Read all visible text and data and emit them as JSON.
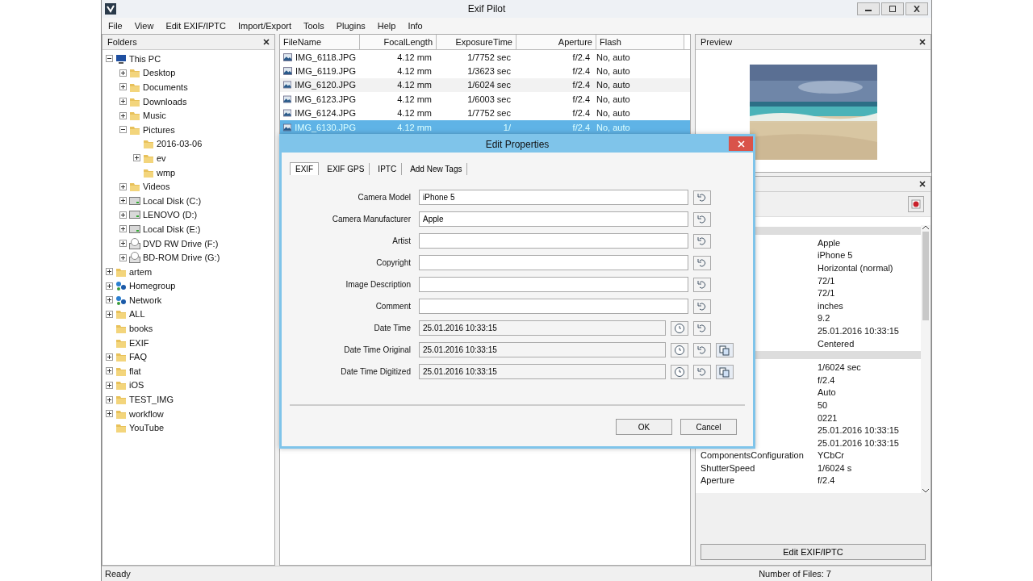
{
  "window": {
    "title": "Exif Pilot"
  },
  "menu": [
    "File",
    "View",
    "Edit EXIF/IPTC",
    "Import/Export",
    "Tools",
    "Plugins",
    "Help",
    "Info"
  ],
  "folders": {
    "title": "Folders",
    "tree": [
      {
        "label": "This PC",
        "kind": "computer",
        "expanded": true,
        "children": [
          {
            "label": "Desktop",
            "kind": "folder",
            "expanded": false
          },
          {
            "label": "Documents",
            "kind": "folder",
            "expanded": false
          },
          {
            "label": "Downloads",
            "kind": "folder",
            "expanded": false
          },
          {
            "label": "Music",
            "kind": "folder",
            "expanded": false
          },
          {
            "label": "Pictures",
            "kind": "folder",
            "expanded": true,
            "children": [
              {
                "label": "2016-03-06",
                "kind": "folder"
              },
              {
                "label": "ev",
                "kind": "folder",
                "expanded": false
              },
              {
                "label": "wmp",
                "kind": "folder"
              }
            ]
          },
          {
            "label": "Videos",
            "kind": "folder",
            "expanded": false
          },
          {
            "label": "Local Disk (C:)",
            "kind": "disk",
            "expanded": false
          },
          {
            "label": "LENOVO (D:)",
            "kind": "disk",
            "expanded": false
          },
          {
            "label": "Local Disk (E:)",
            "kind": "disk",
            "expanded": false
          },
          {
            "label": "DVD RW Drive (F:)",
            "kind": "optical",
            "expanded": false
          },
          {
            "label": "BD-ROM Drive (G:)",
            "kind": "optical",
            "expanded": false
          }
        ]
      },
      {
        "label": "artem",
        "kind": "folder",
        "expanded": false
      },
      {
        "label": "Homegroup",
        "kind": "network",
        "expanded": false
      },
      {
        "label": "Network",
        "kind": "network",
        "expanded": false
      },
      {
        "label": "ALL",
        "kind": "folder",
        "expanded": false
      },
      {
        "label": "books",
        "kind": "folder"
      },
      {
        "label": "EXIF",
        "kind": "folder"
      },
      {
        "label": "FAQ",
        "kind": "folder",
        "expanded": false
      },
      {
        "label": "flat",
        "kind": "folder",
        "expanded": false
      },
      {
        "label": "iOS",
        "kind": "folder",
        "expanded": false
      },
      {
        "label": "TEST_IMG",
        "kind": "folder",
        "expanded": false
      },
      {
        "label": "workflow",
        "kind": "folder",
        "expanded": false
      },
      {
        "label": "YouTube",
        "kind": "folder"
      }
    ]
  },
  "files": {
    "columns": [
      "FileName",
      "FocalLength",
      "ExposureTime",
      "Aperture",
      "Flash"
    ],
    "rows": [
      {
        "cells": [
          "IMG_6118.JPG",
          "4.12 mm",
          "1/7752 sec",
          "f/2.4",
          "No, auto"
        ],
        "selected": false
      },
      {
        "cells": [
          "IMG_6119.JPG",
          "4.12 mm",
          "1/3623 sec",
          "f/2.4",
          "No, auto"
        ],
        "selected": false
      },
      {
        "cells": [
          "IMG_6120.JPG",
          "4.12 mm",
          "1/6024 sec",
          "f/2.4",
          "No, auto"
        ],
        "selected": false
      },
      {
        "cells": [
          "IMG_6123.JPG",
          "4.12 mm",
          "1/6003 sec",
          "f/2.4",
          "No, auto"
        ],
        "selected": false
      },
      {
        "cells": [
          "IMG_6124.JPG",
          "4.12 mm",
          "1/7752 sec",
          "f/2.4",
          "No, auto"
        ],
        "selected": false
      },
      {
        "cells": [
          "IMG_6130.JPG",
          "4.12 mm",
          "1/",
          "f/2.4",
          "No, auto"
        ],
        "selected": true
      }
    ]
  },
  "preview": {
    "title": "Preview"
  },
  "properties": {
    "items": [
      {
        "kind": "group"
      },
      {
        "kind": "row",
        "value": "Apple"
      },
      {
        "kind": "row",
        "value": "iPhone 5"
      },
      {
        "kind": "row",
        "value": "Horizontal (normal)"
      },
      {
        "kind": "row",
        "value": "72/1"
      },
      {
        "kind": "row",
        "value": "72/1"
      },
      {
        "kind": "row",
        "value": "inches"
      },
      {
        "kind": "row",
        "value": "9.2"
      },
      {
        "kind": "row",
        "value": "25.01.2016 10:33:15"
      },
      {
        "kind": "row",
        "value": "Centered"
      },
      {
        "kind": "group"
      },
      {
        "kind": "row",
        "value": "1/6024 sec"
      },
      {
        "kind": "row",
        "value": "f/2.4"
      },
      {
        "kind": "row",
        "value": "Auto"
      },
      {
        "kind": "row",
        "value": "50"
      },
      {
        "kind": "row",
        "value": "0221"
      },
      {
        "kind": "row",
        "value": "25.01.2016 10:33:15"
      },
      {
        "kind": "row",
        "value": "25.01.2016 10:33:15"
      },
      {
        "kind": "row",
        "name": "ComponentsConfiguration",
        "value": "YCbCr"
      },
      {
        "kind": "row",
        "name": "ShutterSpeed",
        "value": "1/6024 s"
      },
      {
        "kind": "row",
        "name": "Aperture",
        "value": "f/2.4"
      }
    ],
    "button": "Edit EXIF/IPTC"
  },
  "status_bar": {
    "left": "Ready",
    "right": "Number of Files: 7"
  },
  "dialog": {
    "title": "Edit Properties",
    "tabs": [
      {
        "label": "EXIF",
        "selected": true
      },
      {
        "label": "EXIF GPS",
        "selected": false
      },
      {
        "label": "IPTC",
        "selected": false
      },
      {
        "label": "Add New Tags",
        "selected": false
      }
    ],
    "fields": [
      {
        "label": "Camera Model",
        "value": "iPhone 5",
        "kind": "text"
      },
      {
        "label": "Camera Manufacturer",
        "value": "Apple",
        "kind": "text"
      },
      {
        "label": "Artist",
        "kind": "text"
      },
      {
        "label": "Copyright",
        "kind": "text"
      },
      {
        "label": "Image Description",
        "kind": "text"
      },
      {
        "label": "Comment",
        "kind": "text"
      },
      {
        "label": "Date Time",
        "value": "25.01.2016 10:33:15",
        "kind": "datetime"
      },
      {
        "label": "Date Time Original",
        "value": "25.01.2016 10:33:15",
        "kind": "datetime_copy"
      },
      {
        "label": "Date Time Digitized",
        "value": "25.01.2016 10:33:15",
        "kind": "datetime_copy"
      }
    ],
    "buttons": [
      "OK",
      "Cancel"
    ]
  }
}
